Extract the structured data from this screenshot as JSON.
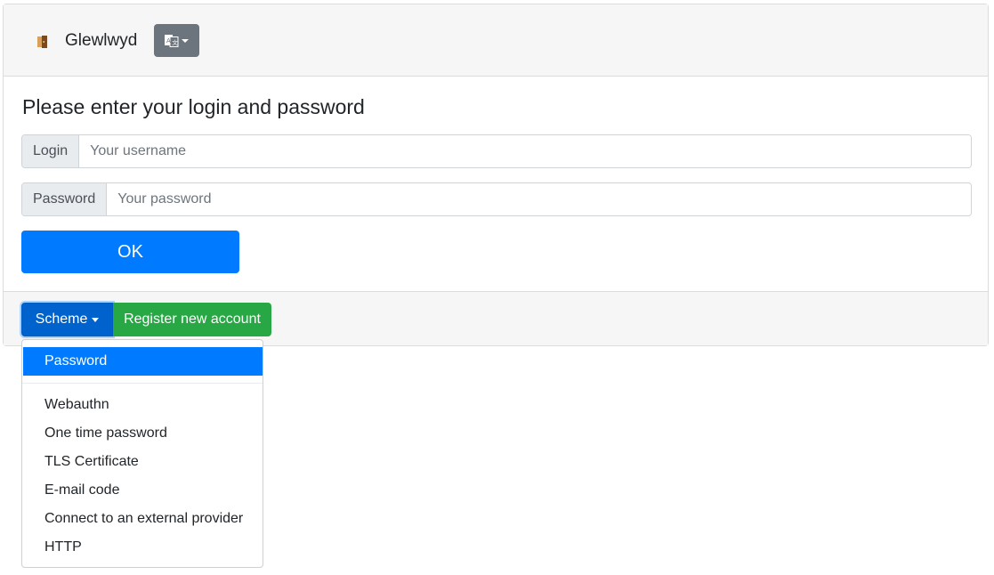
{
  "header": {
    "app_title": "Glewlwyd",
    "language_icon": "translate-icon"
  },
  "login_form": {
    "heading": "Please enter your login and password",
    "login_label": "Login",
    "login_placeholder": "Your username",
    "login_value": "",
    "password_label": "Password",
    "password_placeholder": "Your password",
    "password_value": "",
    "submit_label": "OK"
  },
  "footer": {
    "scheme_label": "Scheme",
    "register_label": "Register new account"
  },
  "scheme_menu": {
    "selected": "Password",
    "items": [
      {
        "label": "Password"
      },
      {
        "label": "Webauthn"
      },
      {
        "label": "One time password"
      },
      {
        "label": "TLS Certificate"
      },
      {
        "label": "E-mail code"
      },
      {
        "label": "Connect to an external provider"
      },
      {
        "label": "HTTP"
      }
    ]
  },
  "colors": {
    "primary": "#007bff",
    "success": "#28a745",
    "secondary": "#6c757d"
  }
}
